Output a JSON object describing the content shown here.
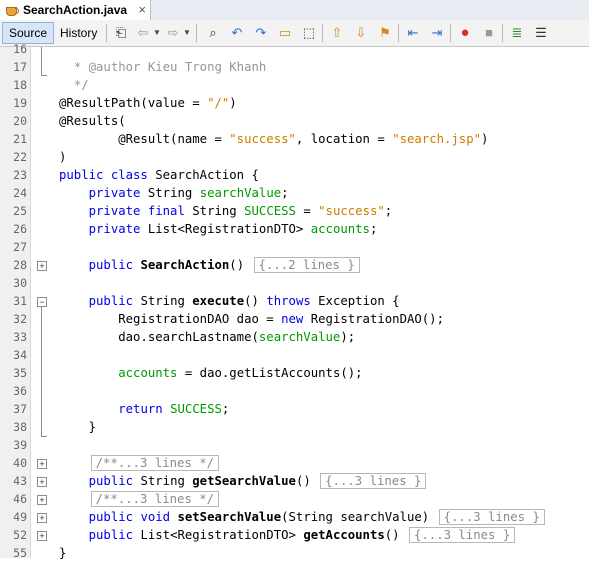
{
  "tab": {
    "title": "SearchAction.java",
    "close": "×"
  },
  "toolbar": {
    "source_label": "Source",
    "history_label": "History"
  },
  "lines": [
    {
      "num": "16",
      "html": ""
    },
    {
      "num": "17",
      "html": "  <span class=\"cmt\">* @author Kieu Trong Khanh</span>"
    },
    {
      "num": "18",
      "html": "  <span class=\"cmt\">*/</span>"
    },
    {
      "num": "19",
      "html": "@ResultPath(value = <span class=\"str\">\"/\"</span>)"
    },
    {
      "num": "20",
      "html": "@Results("
    },
    {
      "num": "21",
      "html": "        @Result(name = <span class=\"str\">\"success\"</span>, location = <span class=\"str\">\"search.jsp\"</span>)"
    },
    {
      "num": "22",
      "html": ")"
    },
    {
      "num": "23",
      "html": "<span class=\"kw\">public class</span> SearchAction {"
    },
    {
      "num": "24",
      "html": "    <span class=\"kw\">private</span> String <span class=\"fld\">searchValue</span>;"
    },
    {
      "num": "25",
      "html": "    <span class=\"kw\">private final</span> String <span class=\"fld\">SUCCESS</span> = <span class=\"str\">\"success\"</span>;"
    },
    {
      "num": "26",
      "html": "    <span class=\"kw\">private</span> List&lt;RegistrationDTO&gt; <span class=\"fld\">accounts</span>;"
    },
    {
      "num": "27",
      "html": ""
    },
    {
      "num": "28",
      "html": "    <span class=\"kw\">public</span> <span class=\"bold\">SearchAction</span>() <span class=\"collapsed\">{...2 lines }</span>"
    },
    {
      "num": "30",
      "html": ""
    },
    {
      "num": "31",
      "html": "    <span class=\"kw\">public</span> String <span class=\"bold\">execute</span>() <span class=\"kw\">throws</span> Exception {"
    },
    {
      "num": "32",
      "html": "        RegistrationDAO dao = <span class=\"kw\">new</span> RegistrationDAO();"
    },
    {
      "num": "33",
      "html": "        dao.searchLastname(<span class=\"fld\">searchValue</span>);"
    },
    {
      "num": "34",
      "html": ""
    },
    {
      "num": "35",
      "html": "        <span class=\"fld\">accounts</span> = dao.getListAccounts();"
    },
    {
      "num": "36",
      "html": ""
    },
    {
      "num": "37",
      "html": "        <span class=\"kw\">return</span> <span class=\"fld\">SUCCESS</span>;"
    },
    {
      "num": "38",
      "html": "    }"
    },
    {
      "num": "39",
      "html": ""
    },
    {
      "num": "40",
      "html": "    <span class=\"collapsed\">/**...3 lines */</span>"
    },
    {
      "num": "43",
      "html": "    <span class=\"kw\">public</span> String <span class=\"bold\">getSearchValue</span>() <span class=\"collapsed\">{...3 lines }</span>"
    },
    {
      "num": "46",
      "html": "    <span class=\"collapsed\">/**...3 lines */</span>"
    },
    {
      "num": "49",
      "html": "    <span class=\"kw\">public void</span> <span class=\"bold\">setSearchValue</span>(String searchValue) <span class=\"collapsed\">{...3 lines }</span>"
    },
    {
      "num": "52",
      "html": "    <span class=\"kw\">public</span> List&lt;RegistrationDTO&gt; <span class=\"bold\">getAccounts</span>() <span class=\"collapsed\">{...3 lines }</span>"
    },
    {
      "num": "55",
      "html": "}"
    }
  ]
}
